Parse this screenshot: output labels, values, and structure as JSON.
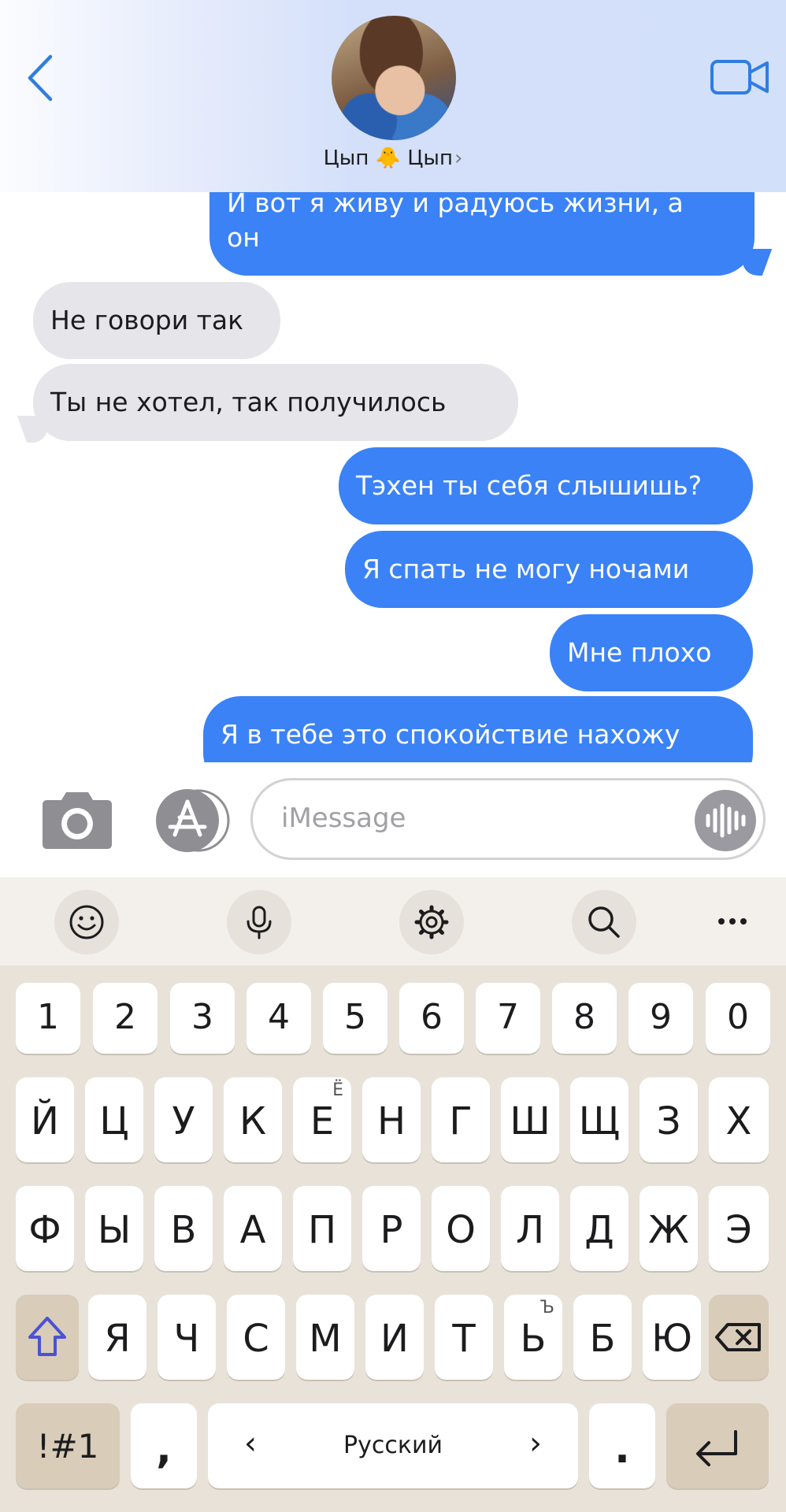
{
  "header": {
    "contact_name": "Цып 🐥 Цып",
    "back_icon": "chevron-left-icon",
    "video_icon": "video-camera-icon",
    "accent_color": "#2f7de1"
  },
  "messages": [
    {
      "from": "me",
      "lines": [
        "И вот я живу и радуюсь жизни,  а",
        "он"
      ]
    },
    {
      "from": "them",
      "lines": [
        "Не говори так"
      ]
    },
    {
      "from": "them",
      "lines": [
        "Ты не хотел,  так получилось"
      ]
    },
    {
      "from": "me",
      "lines": [
        "Тэхен ты себя слышишь?"
      ]
    },
    {
      "from": "me",
      "lines": [
        "Я спать не могу ночами"
      ]
    },
    {
      "from": "me",
      "lines": [
        "Мне плохо"
      ]
    },
    {
      "from": "me",
      "lines": [
        "Я в тебе это спокойствие нахожу"
      ]
    }
  ],
  "colors": {
    "outgoing_bubble": "#3b82f6",
    "incoming_bubble": "#e5e5ea",
    "keyboard_bg": "#e8e2d9"
  },
  "input": {
    "placeholder": "iMessage",
    "camera_icon": "camera-icon",
    "apps_icon": "app-store-icon",
    "voice_icon": "waveform-icon"
  },
  "keyboard_toolbar": [
    "emoji-icon",
    "microphone-icon",
    "gear-icon",
    "search-icon",
    "more-icon"
  ],
  "keyboard": {
    "numbers": [
      "1",
      "2",
      "3",
      "4",
      "5",
      "6",
      "7",
      "8",
      "9",
      "0"
    ],
    "row1": [
      "Й",
      "Ц",
      "У",
      "К",
      "Е",
      "Н",
      "Г",
      "Ш",
      "Щ",
      "З",
      "Х"
    ],
    "row1_alt": {
      "Е": "Ё"
    },
    "row2": [
      "Ф",
      "Ы",
      "В",
      "А",
      "П",
      "Р",
      "О",
      "Л",
      "Д",
      "Ж",
      "Э"
    ],
    "row3": [
      "Я",
      "Ч",
      "С",
      "М",
      "И",
      "Т",
      "Ь",
      "Б",
      "Ю"
    ],
    "row3_alt": {
      "Ь": "Ъ"
    },
    "symbols_key": "!#1",
    "comma_key": ",",
    "space_label": "Русский",
    "period_key": "."
  }
}
